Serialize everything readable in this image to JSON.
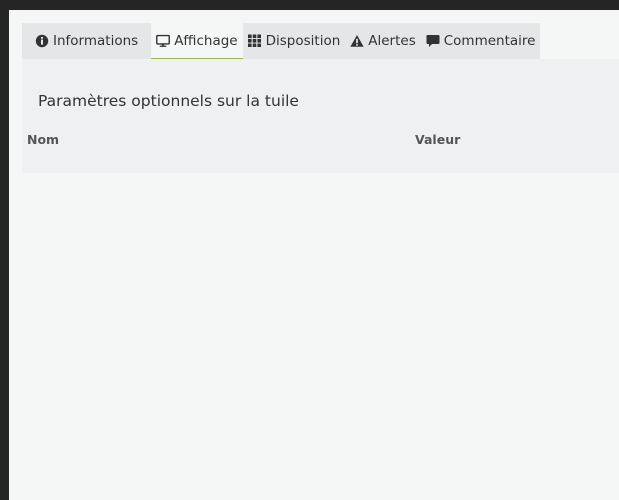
{
  "tabs": [
    {
      "label": "Informations",
      "icon": "info-circle-icon"
    },
    {
      "label": "Affichage",
      "icon": "desktop-icon"
    },
    {
      "label": "Disposition",
      "icon": "grid-icon"
    },
    {
      "label": "Alertes",
      "icon": "warning-icon"
    },
    {
      "label": "Commentaire",
      "icon": "comment-icon"
    }
  ],
  "active_tab": "Affichage",
  "panel": {
    "title": "Paramètres optionnels sur la tuile",
    "columns": [
      "Nom",
      "Valeur"
    ]
  },
  "colors": {
    "accent": "#94ca02",
    "chrome": "#252526",
    "tab_bar": "#e5e6e7",
    "panel": "#eff0f2"
  }
}
